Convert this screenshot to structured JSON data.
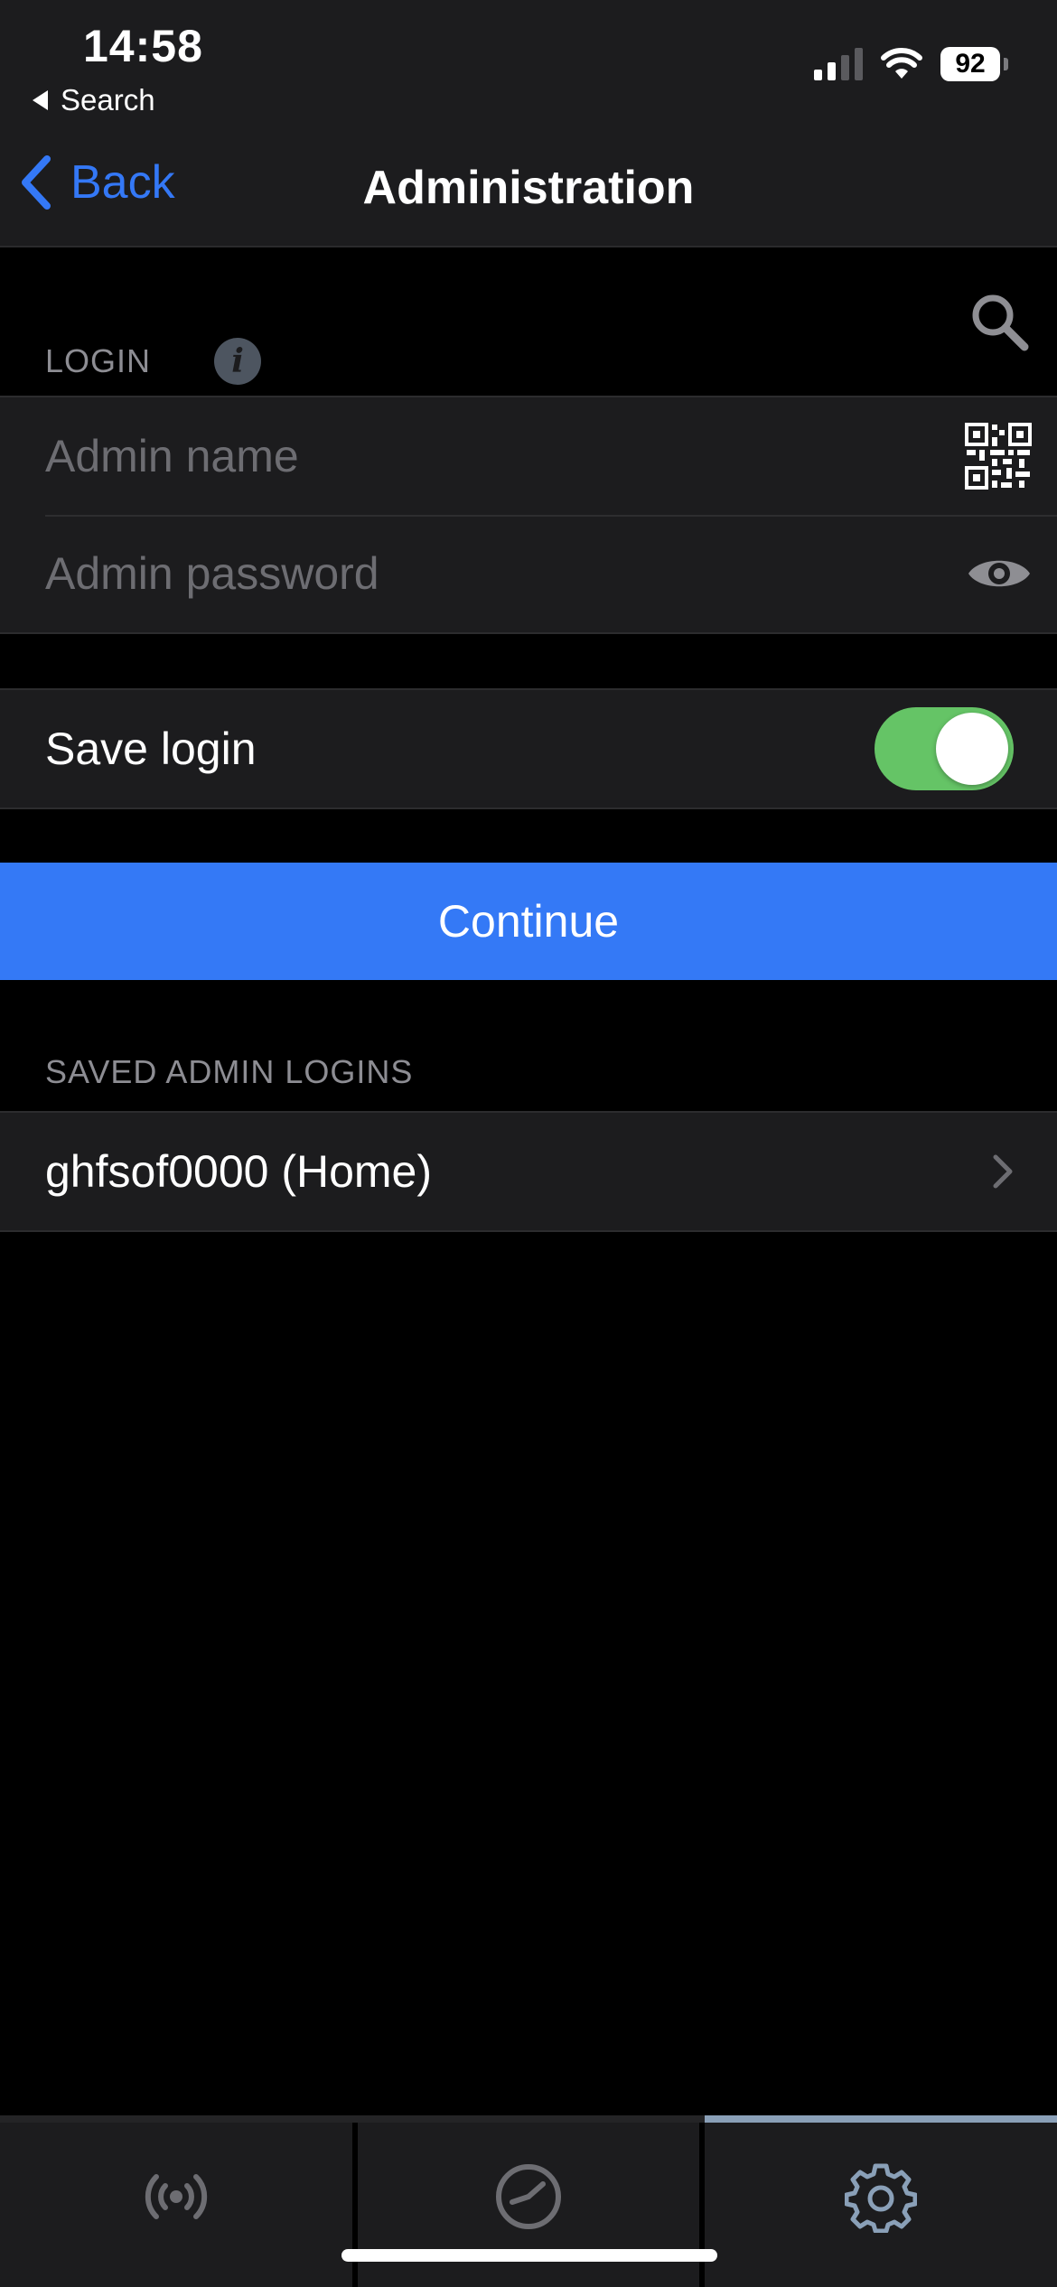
{
  "status_bar": {
    "time": "14:58",
    "back_app": "Search",
    "battery": "92",
    "signal_icon": "cellular-signal-icon",
    "wifi_icon": "wifi-icon"
  },
  "nav": {
    "back_label": "Back",
    "title": "Administration"
  },
  "login": {
    "section_label": "LOGIN",
    "admin_name_placeholder": "Admin name",
    "admin_password_placeholder": "Admin password",
    "qr_icon": "qr-code-icon",
    "eye_icon": "eye-icon",
    "search_icon": "search-icon",
    "info_icon": "info-icon"
  },
  "save_login": {
    "label": "Save login",
    "enabled": true
  },
  "continue_label": "Continue",
  "saved": {
    "section_label": "SAVED ADMIN LOGINS",
    "items": [
      {
        "label": "ghfsof0000 (Home)"
      }
    ]
  },
  "tabs": [
    {
      "icon": "broadcast-icon",
      "active": false
    },
    {
      "icon": "gauge-icon",
      "active": false
    },
    {
      "icon": "gear-icon",
      "active": true
    }
  ],
  "colors": {
    "accent": "#3478f6",
    "toggle_on": "#65c466",
    "background": "#000000",
    "cell": "#1c1c1e"
  }
}
